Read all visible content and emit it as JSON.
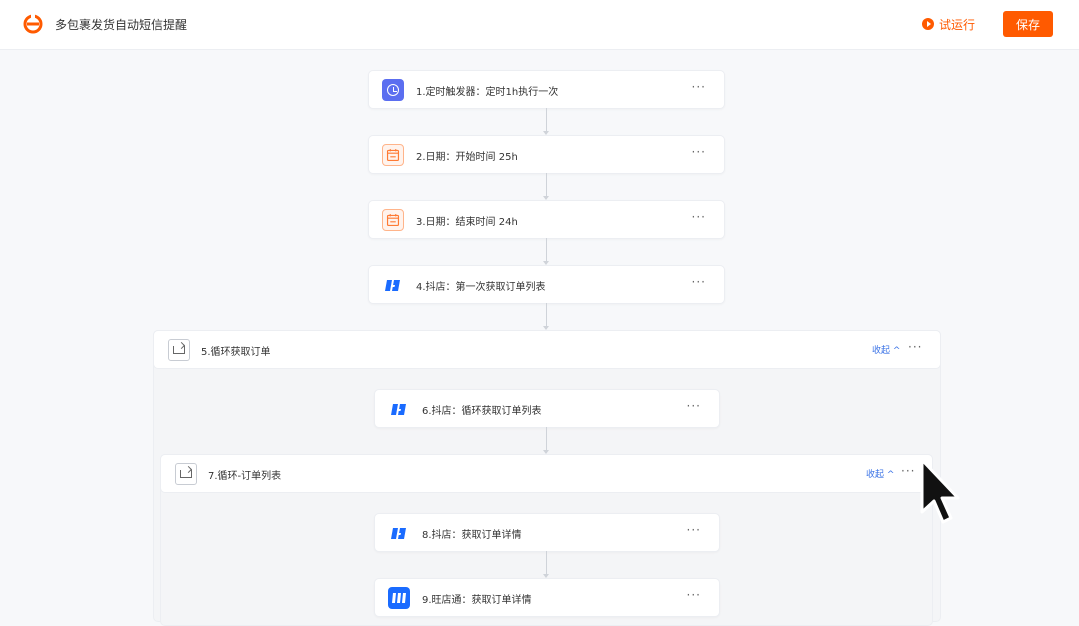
{
  "header": {
    "title": "多包裹发货自动短信提醒",
    "run_label": "试运行",
    "save_label": "保存"
  },
  "nodes": [
    {
      "label": "1.定时触发器：定时1h执行一次",
      "icon": "clock-icon"
    },
    {
      "label": "2.日期：开始时间 25h",
      "icon": "calendar-icon"
    },
    {
      "label": "3.日期：结束时间 24h",
      "icon": "calendar-icon"
    },
    {
      "label": "4.抖店：第一次获取订单列表",
      "icon": "douyin-icon"
    },
    {
      "label": "6.抖店：循环获取订单列表",
      "icon": "douyin-icon"
    },
    {
      "label": "8.抖店：获取订单详情",
      "icon": "douyin-icon"
    },
    {
      "label": "9.旺店通：获取订单详情",
      "icon": "wangdiantong-icon"
    }
  ],
  "loops": [
    {
      "label": "5.循环获取订单",
      "collapse": "收起 ^",
      "icon": "loop-icon"
    },
    {
      "label": "7.循环-订单列表",
      "collapse": "收起 ^",
      "icon": "loop-icon"
    }
  ],
  "more_label": "···",
  "colors": {
    "accent": "#ff5a00",
    "link": "#3b73e6",
    "trigger": "#5b6ef0",
    "douyin": "#1a6bff"
  }
}
